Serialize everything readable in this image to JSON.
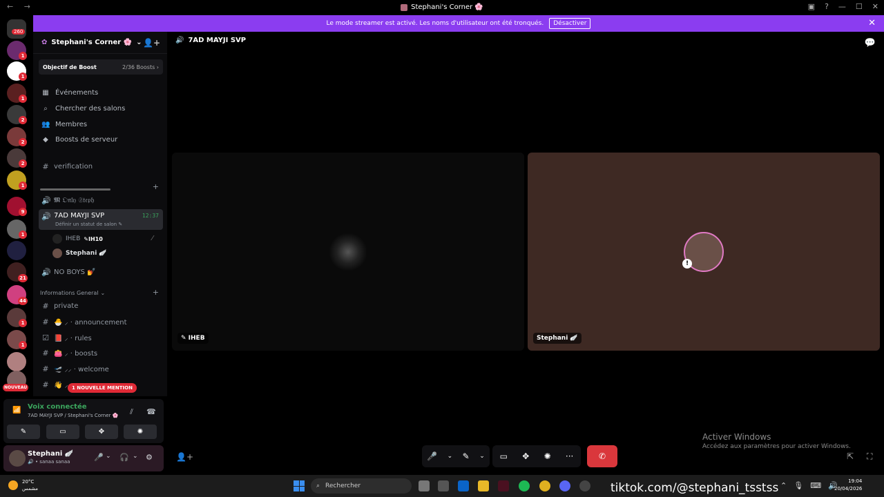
{
  "window": {
    "title": "Stephani's Corner 🌸",
    "nav_symbols": "←  →",
    "controls": [
      "▣",
      "?",
      "—",
      "☐",
      "✕"
    ]
  },
  "banner": {
    "text": "Le mode streamer est activé. Les noms d'utilisateur ont été tronqués.",
    "button": "Désactiver",
    "close": "✕"
  },
  "rail": {
    "dm_badge": "260",
    "badges": [
      "1",
      "1",
      "1",
      "2",
      "2",
      "2",
      "1",
      "9",
      "1",
      "1",
      "21",
      "44",
      "1",
      "1"
    ],
    "nouveau": "NOUVEAU"
  },
  "sidebar": {
    "server_name": "Stephani's Corner 🌸",
    "chevron": "⌄",
    "invite_icon": "👤+",
    "boost_label": "Objectif de Boost",
    "boost_count": "2/36 Boosts",
    "boost_chevron": "›",
    "menu": [
      {
        "icon": "▦",
        "label": "Événements"
      },
      {
        "icon": "⌕",
        "label": "Chercher des salons"
      },
      {
        "icon": "👥",
        "label": "Membres"
      },
      {
        "icon": "◆",
        "label": "Boosts de serveur"
      }
    ],
    "verification": "verification",
    "voice_only_steph": "𝕸 𝔒𝔫𝔩𝔶 𝔖𝔱𝔢𝔭𝔥",
    "active_channel": {
      "name": "7AD MAYJI SVP",
      "sub": "Définir un statut de salon ✎",
      "time": "12:37"
    },
    "members": [
      {
        "name": "IHEB",
        "tag": "✎IH10"
      },
      {
        "name": "Stephani 🪽",
        "tag": ""
      }
    ],
    "no_boys": "NO BOYS 💅",
    "category": "Informations General",
    "category_chevron": "⌄",
    "text_channels": [
      "private",
      "🐣 ⸝ · announcement",
      "📕 ⸝ · rules",
      "👛 ⸝ · boosts",
      "🛫 ⸝⸝ · welcome",
      "👋 ⸝⸝"
    ],
    "mention_pill": "1 NOUVELLE MENTION"
  },
  "voice_panel": {
    "status": "Voix connectée",
    "channel": "7AD MAYJI SVP / Stephani's Corner 🌸",
    "buttons": [
      "✎",
      "▭",
      "✥",
      "✺"
    ]
  },
  "user": {
    "name": "Stephani 🪽",
    "status": "🔊 • sanaa sanaa"
  },
  "main": {
    "channel_title": "7AD MAYJI SVP",
    "tiles": [
      {
        "name": "✎ IHEB"
      },
      {
        "name": "Stephani 🪽"
      }
    ]
  },
  "controls": {
    "mic": "🎤",
    "chev": "⌄",
    "cam": "✎",
    "share": "▭",
    "activity": "✥",
    "soundboard": "✺",
    "more": "···",
    "hangup": "✆"
  },
  "watermark": {
    "line1": "Activer Windows",
    "line2": "Accédez aux paramètres pour activer Windows."
  },
  "taskbar": {
    "temp": "20°C",
    "weather_sub": "مشمس",
    "search": "Rechercher",
    "tiktok": "tiktok.com/@stephani_tsstss",
    "time": "19:04",
    "date": "20/04/2026"
  }
}
